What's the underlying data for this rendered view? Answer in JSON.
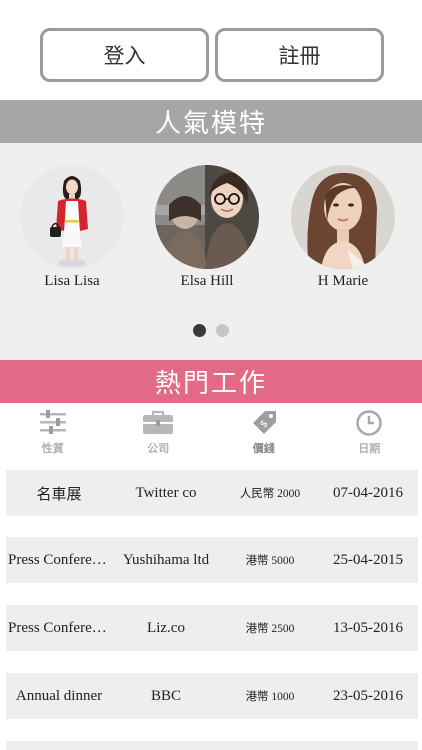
{
  "auth": {
    "login_label": "登入",
    "register_label": "註冊"
  },
  "models_section": {
    "title": "人氣模特",
    "models": [
      {
        "name": "Lisa Lisa"
      },
      {
        "name": "Elsa Hill"
      },
      {
        "name": "H Marie"
      }
    ],
    "carousel": {
      "pages": 2,
      "active_page": 1
    }
  },
  "jobs_section": {
    "title": "熱門工作",
    "filters": [
      {
        "label": "性質",
        "icon": "sliders-icon"
      },
      {
        "label": "公司",
        "icon": "briefcase-icon"
      },
      {
        "label": "價錢",
        "icon": "price-tag-icon"
      },
      {
        "label": "日期",
        "icon": "clock-icon"
      }
    ],
    "jobs": [
      {
        "type": "名車展",
        "company": "Twitter co",
        "price": "人民幣 2000",
        "date": "07-04-2016"
      },
      {
        "type": "Press Conference",
        "company": "Yushihama ltd",
        "price": "港幣 5000",
        "date": "25-04-2015"
      },
      {
        "type": "Press Conference",
        "company": "Liz.co",
        "price": "港幣 2500",
        "date": "13-05-2016"
      },
      {
        "type": "Annual dinner",
        "company": "BBC",
        "price": "港幣 1000",
        "date": "23-05-2016"
      }
    ]
  },
  "colors": {
    "models_header": "#a6a6a6",
    "jobs_header": "#e36a86",
    "row_bg": "#eeeeee"
  }
}
